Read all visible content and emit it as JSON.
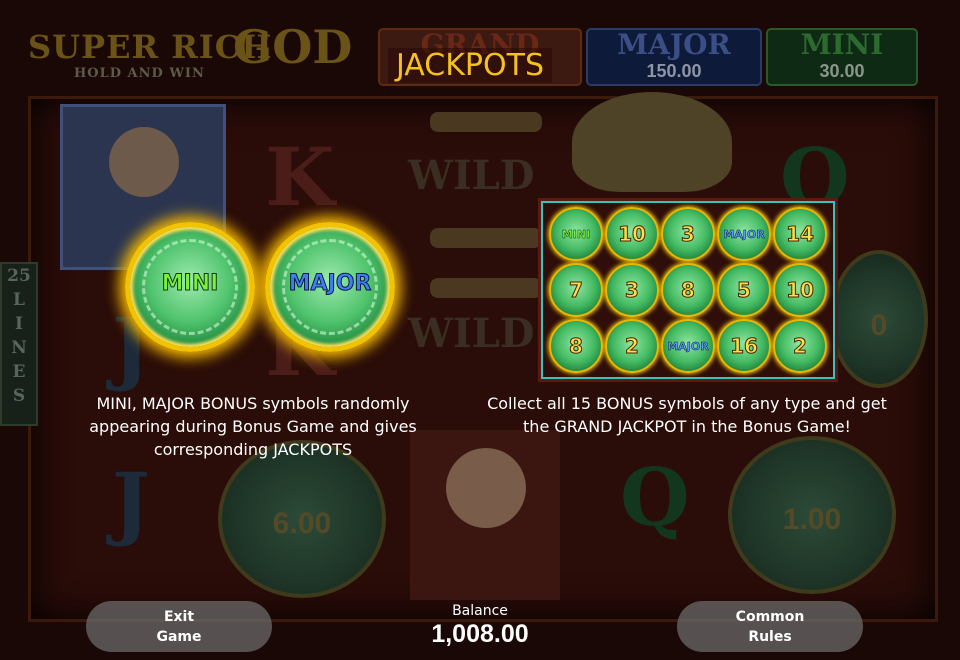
{
  "game": {
    "logo_line1": "SUPER RICH",
    "logo_line1b": "GOD",
    "logo_line2": "HOLD AND WIN",
    "lines_label": [
      "25",
      "L",
      "I",
      "N",
      "E",
      "S"
    ]
  },
  "jackpot_bar": {
    "grand": {
      "name": "GRAND",
      "value": ""
    },
    "major": {
      "name": "MAJOR",
      "value": "150.00"
    },
    "mini": {
      "name": "MINI",
      "value": "30.00"
    }
  },
  "background_reels": {
    "wild1": "WILD",
    "wild2": "WILD",
    "k1": "K",
    "k2": "K",
    "q1": "Q",
    "q2": "Q",
    "j1": "J",
    "j2": "J",
    "coin_left_value": "6.00",
    "coin_right_value": "1.00",
    "coin_edge_value": "0"
  },
  "help": {
    "title": "JACKPOTS",
    "coin_mini_label": "MINI",
    "coin_major_label": "MAJOR",
    "left_text": "MINI, MAJOR BONUS symbols randomly appearing during Bonus Game and gives corresponding JACKPOTS",
    "right_text": "Collect all 15 BONUS symbols of any type and get the GRAND JACKPOT in the Bonus Game!",
    "grid": [
      [
        "MINI",
        "10",
        "3",
        "MAJOR",
        "14"
      ],
      [
        "7",
        "3",
        "8",
        "5",
        "10"
      ],
      [
        "8",
        "2",
        "MAJOR",
        "16",
        "2"
      ]
    ]
  },
  "controls": {
    "exit_line1": "Exit",
    "exit_line2": "Game",
    "rules_line1": "Common",
    "rules_line2": "Rules",
    "balance_label": "Balance",
    "balance_value": "1,008.00"
  }
}
